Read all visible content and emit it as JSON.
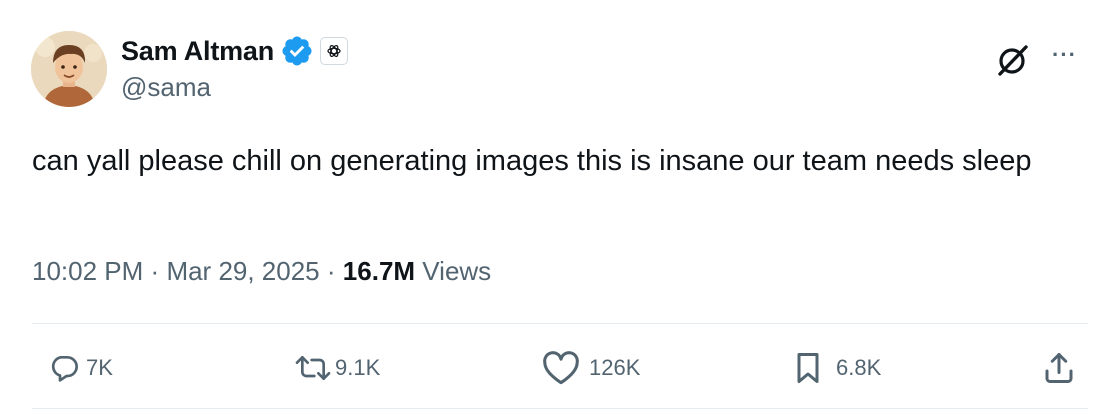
{
  "author": {
    "display_name": "Sam Altman",
    "handle": "@sama",
    "verified": true,
    "affiliate_badge": "openai-logo-icon",
    "avatar": "avatar"
  },
  "tweet": {
    "text": "can yall please chill on generating images this is insane our team needs sleep",
    "time": "10:02 PM",
    "separator": "·",
    "date": "Mar 29, 2025",
    "views_count": "16.7M",
    "views_label": "Views"
  },
  "actions": {
    "replies": "7K",
    "reposts": "9.1K",
    "likes": "126K",
    "bookmarks": "6.8K"
  },
  "icons": {
    "grok": "grok-icon",
    "more": "more-icon",
    "reply": "reply-icon",
    "repost": "repost-icon",
    "like": "heart-icon",
    "bookmark": "bookmark-icon",
    "share": "share-icon"
  },
  "colors": {
    "verified": "#1d9bf0",
    "text_primary": "#0f1419",
    "text_secondary": "#536471",
    "divider": "#e6ecf0"
  }
}
